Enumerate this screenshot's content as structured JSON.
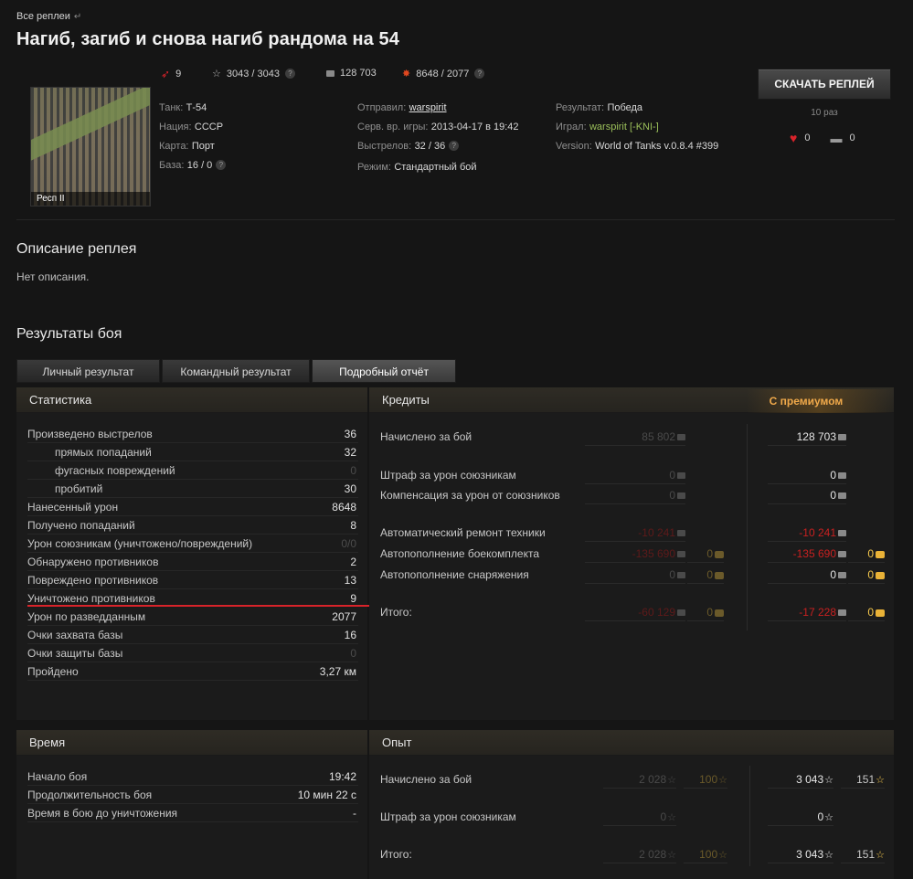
{
  "breadcrumb": "Все реплеи",
  "title": "Нагиб, загиб и снова нагиб рандома на 54",
  "header_stats": {
    "kills": "9",
    "xp": "3043 / 3043",
    "credits": "128 703",
    "damage": "8648 / 2077"
  },
  "map_label": "Респ II",
  "info": {
    "tank_label": "Танк:",
    "tank": "Т-54",
    "nation_label": "Нация:",
    "nation": "СССР",
    "map_label": "Карта:",
    "map": "Порт",
    "base_label": "База:",
    "base": "16 / 0",
    "sender_label": "Отправил:",
    "sender": "warspirit",
    "server_time_label": "Серв. вр. игры:",
    "server_time": "2013-04-17 в 19:42",
    "shots_label": "Выстрелов:",
    "shots": "32 / 36",
    "mode_label": "Режим:",
    "mode": "Стандартный бой",
    "result_label": "Результат:",
    "result": "Победа",
    "played_label": "Играл:",
    "played": "warspirit [-KNI-]",
    "version_label": "Version:",
    "version": "World of Tanks v.0.8.4 #399"
  },
  "download": {
    "label": "СКАЧАТЬ РЕПЛЕЙ",
    "times": "10 раз",
    "likes": "0",
    "comments": "0"
  },
  "description": {
    "heading": "Описание реплея",
    "text": "Нет описания."
  },
  "results": {
    "heading": "Результаты боя",
    "tabs": [
      "Личный результат",
      "Командный результат",
      "Подробный отчёт"
    ]
  },
  "statistics": {
    "title": "Статистика",
    "rows": [
      {
        "label": "Произведено выстрелов",
        "value": "36"
      },
      {
        "label": "прямых попаданий",
        "value": "32"
      },
      {
        "label": "фугасных повреждений",
        "value": "0"
      },
      {
        "label": "пробитий",
        "value": "30"
      },
      {
        "label": "Нанесенный урон",
        "value": "8648"
      },
      {
        "label": "Получено попаданий",
        "value": "8"
      },
      {
        "label": "Урон союзникам (уничтожено/повреждений)",
        "value": "0/0"
      },
      {
        "label": "Обнаружено противников",
        "value": "2"
      },
      {
        "label": "Повреждено противников",
        "value": "13"
      },
      {
        "label": "Уничтожено противников",
        "value": "9"
      },
      {
        "label": "Урон по разведданным",
        "value": "2077"
      },
      {
        "label": "Очки захвата базы",
        "value": "16"
      },
      {
        "label": "Очки защиты базы",
        "value": "0"
      },
      {
        "label": "Пройдено",
        "value": "3,27 км"
      }
    ]
  },
  "credits": {
    "title": "Кредиты",
    "premium_title": "С премиумом",
    "rows": [
      {
        "label": "Начислено за бой",
        "base": "85 802",
        "base_gold": "",
        "prem": "128 703",
        "prem_gold": ""
      },
      {
        "label": "Штраф за урон союзникам",
        "base": "0",
        "base_gold": "",
        "prem": "0",
        "prem_gold": ""
      },
      {
        "label": "Компенсация за урон от союзников",
        "base": "0",
        "base_gold": "",
        "prem": "0",
        "prem_gold": ""
      },
      {
        "label": "Автоматический ремонт техники",
        "base": "-10 241",
        "base_gold": "",
        "prem": "-10 241",
        "prem_gold": ""
      },
      {
        "label": "Автопополнение боекомплекта",
        "base": "-135 690",
        "base_gold": "0",
        "prem": "-135 690",
        "prem_gold": "0"
      },
      {
        "label": "Автопополнение снаряжения",
        "base": "0",
        "base_gold": "0",
        "prem": "0",
        "prem_gold": "0"
      },
      {
        "label": "Итого:",
        "base": "-60 129",
        "base_gold": "0",
        "prem": "-17 228",
        "prem_gold": "0"
      }
    ]
  },
  "time": {
    "title": "Время",
    "rows": [
      {
        "label": "Начало боя",
        "value": "19:42"
      },
      {
        "label": "Продолжительность боя",
        "value": "10 мин 22 с"
      },
      {
        "label": "Время в бою до уничтожения",
        "value": "-"
      }
    ]
  },
  "experience": {
    "title": "Опыт",
    "rows": [
      {
        "label": "Начислено за бой",
        "base": "2 028",
        "base_free": "100",
        "prem": "3 043",
        "prem_free": "151"
      },
      {
        "label": "Штраф за урон союзникам",
        "base": "0",
        "base_free": "",
        "prem": "0",
        "prem_free": ""
      },
      {
        "label": "Итого:",
        "base": "2 028",
        "base_free": "100",
        "prem": "3 043",
        "prem_free": "151"
      }
    ]
  }
}
